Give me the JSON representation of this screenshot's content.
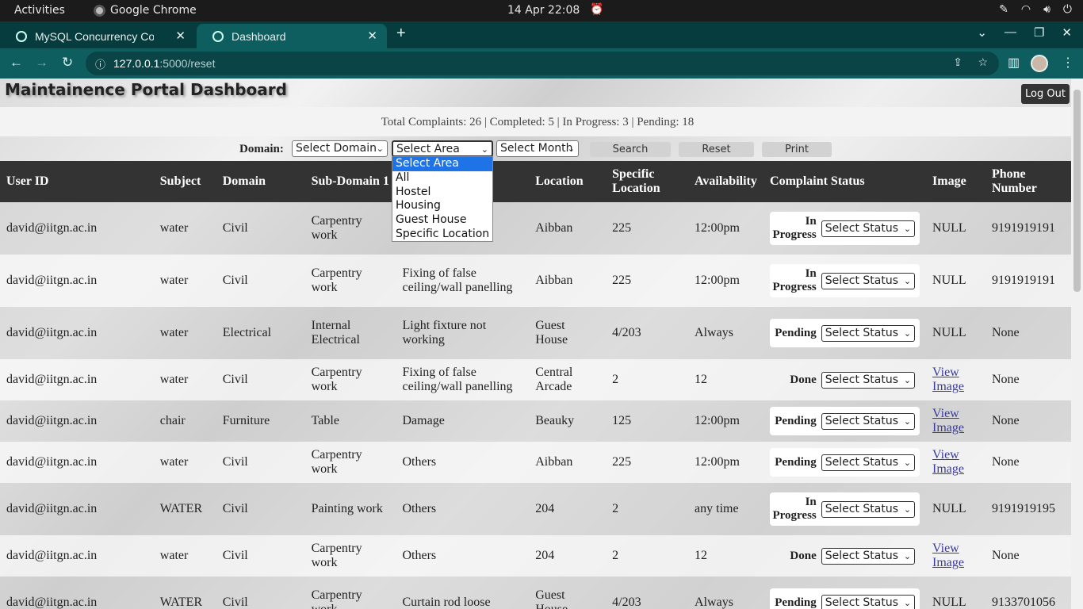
{
  "system_bar": {
    "activities": "Activities",
    "app_name": "Google Chrome",
    "clock": "14 Apr  22:08"
  },
  "browser": {
    "tabs": [
      {
        "title": "MySQL Concurrency Cont"
      },
      {
        "title": "Dashboard"
      }
    ],
    "url_host": "127.0.0.1",
    "url_path": ":5000/reset"
  },
  "page": {
    "title": "Maintainence Portal Dashboard",
    "logout_label": "Log Out",
    "summary": "Total Complaints: 26 | Completed: 5 | In Progress: 3 | Pending: 18",
    "filters": {
      "domain_label": "Domain:",
      "domain_select": "Select Domain",
      "area_select": "Select Area",
      "month_select": "Select Month",
      "search_label": "Search",
      "reset_label": "Reset",
      "print_label": "Print"
    },
    "area_options": [
      "Select Area",
      "All",
      "Hostel",
      "Housing",
      "Guest House",
      "Specific Location"
    ],
    "columns": [
      "User ID",
      "Subject",
      "Domain",
      "Sub-Domain 1",
      "Sub-Domain 2",
      "Location",
      "Specific Location",
      "Availability",
      "Complaint Status",
      "Image",
      "Phone Number"
    ],
    "status_select_label": "Select Status",
    "rows": [
      {
        "user": "david@iitgn.ac.in",
        "subject": "water",
        "domain": "Civil",
        "sub1": "Carpentry work",
        "sub2": "",
        "location": "Aibban",
        "spec": "225",
        "avail": "12:00pm",
        "status": "In Progress",
        "image": "NULL",
        "phone": "9191919191"
      },
      {
        "user": "david@iitgn.ac.in",
        "subject": "water",
        "domain": "Civil",
        "sub1": "Carpentry work",
        "sub2": "Fixing of false ceiling/wall panelling",
        "location": "Aibban",
        "spec": "225",
        "avail": "12:00pm",
        "status": "In Progress",
        "image": "NULL",
        "phone": "9191919191"
      },
      {
        "user": "david@iitgn.ac.in",
        "subject": "water",
        "domain": "Electrical",
        "sub1": "Internal Electrical",
        "sub2": "Light fixture not working",
        "location": "Guest House",
        "spec": "4/203",
        "avail": "Always",
        "status": "Pending",
        "image": "NULL",
        "phone": "None"
      },
      {
        "user": "david@iitgn.ac.in",
        "subject": "water",
        "domain": "Civil",
        "sub1": "Carpentry work",
        "sub2": "Fixing of false ceiling/wall panelling",
        "location": "Central Arcade",
        "spec": "2",
        "avail": "12",
        "status": "Done",
        "image": "View Image",
        "phone": "None"
      },
      {
        "user": "david@iitgn.ac.in",
        "subject": "chair",
        "domain": "Furniture",
        "sub1": "Table",
        "sub2": "Damage",
        "location": "Beauky",
        "spec": "125",
        "avail": "12:00pm",
        "status": "Pending",
        "image": "View Image",
        "phone": "None"
      },
      {
        "user": "david@iitgn.ac.in",
        "subject": "water",
        "domain": "Civil",
        "sub1": "Carpentry work",
        "sub2": "Others",
        "location": "Aibban",
        "spec": "225",
        "avail": "12:00pm",
        "status": "Pending",
        "image": "View Image",
        "phone": "None"
      },
      {
        "user": "david@iitgn.ac.in",
        "subject": "WATER",
        "domain": "Civil",
        "sub1": "Painting work",
        "sub2": "Others",
        "location": "204",
        "spec": "2",
        "avail": "any time",
        "status": "In Progress",
        "image": "NULL",
        "phone": "9191919195"
      },
      {
        "user": "david@iitgn.ac.in",
        "subject": "water",
        "domain": "Civil",
        "sub1": "Carpentry work",
        "sub2": "Others",
        "location": "204",
        "spec": "2",
        "avail": "12",
        "status": "Done",
        "image": "View Image",
        "phone": "None"
      },
      {
        "user": "david@iitgn.ac.in",
        "subject": "WATER",
        "domain": "Civil",
        "sub1": "Carpentry work",
        "sub2": "Curtain rod loose",
        "location": "Guest House",
        "spec": "4/203",
        "avail": "Always",
        "status": "Pending",
        "image": "NULL",
        "phone": "9133701056"
      }
    ]
  }
}
